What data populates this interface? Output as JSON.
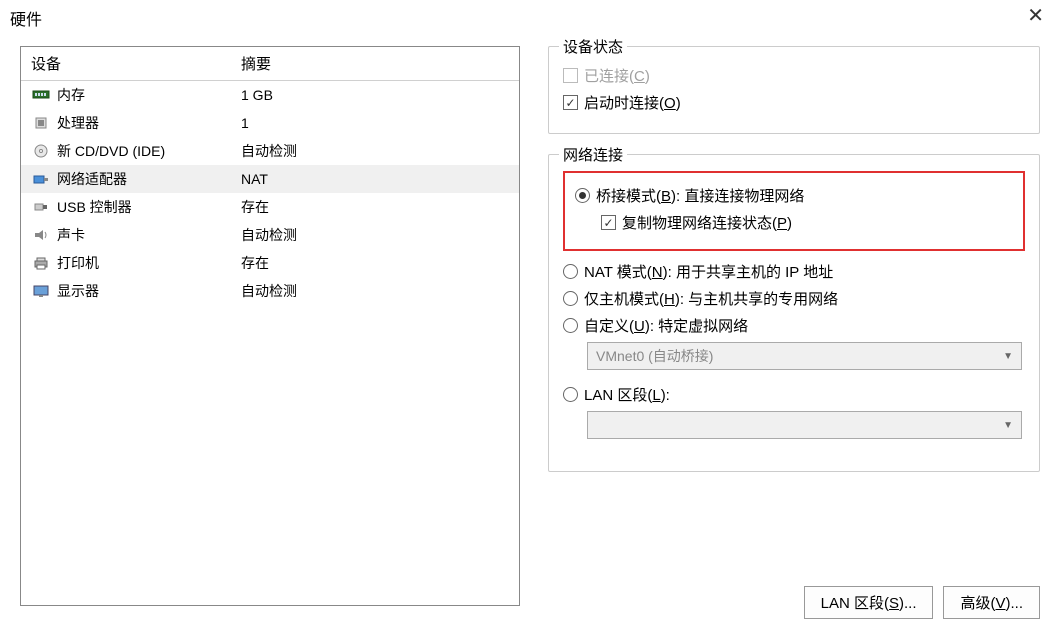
{
  "window_title": "硬件",
  "device_panel": {
    "col_device": "设备",
    "col_summary": "摘要",
    "rows": [
      {
        "icon": "memory-icon",
        "name": "内存",
        "summary": "1 GB",
        "selected": false
      },
      {
        "icon": "cpu-icon",
        "name": "处理器",
        "summary": "1",
        "selected": false
      },
      {
        "icon": "cd-icon",
        "name": "新 CD/DVD (IDE)",
        "summary": "自动检测",
        "selected": false
      },
      {
        "icon": "nic-icon",
        "name": "网络适配器",
        "summary": "NAT",
        "selected": true
      },
      {
        "icon": "usb-icon",
        "name": "USB 控制器",
        "summary": "存在",
        "selected": false
      },
      {
        "icon": "sound-icon",
        "name": "声卡",
        "summary": "自动检测",
        "selected": false
      },
      {
        "icon": "printer-icon",
        "name": "打印机",
        "summary": "存在",
        "selected": false
      },
      {
        "icon": "display-icon",
        "name": "显示器",
        "summary": "自动检测",
        "selected": false
      }
    ]
  },
  "status": {
    "legend": "设备状态",
    "connected_label": "已连接",
    "connected_accel": "C",
    "connected_checked": false,
    "connected_enabled": false,
    "connect_at_power_label": "启动时连接",
    "connect_at_power_accel": "O",
    "connect_at_power_checked": true
  },
  "network": {
    "legend": "网络连接",
    "bridge_label_pre": "桥接模式(",
    "bridge_accel": "B",
    "bridge_label_post": "): 直接连接物理网络",
    "bridge_selected": true,
    "replicate_label_pre": "复制物理网络连接状态(",
    "replicate_accel": "P",
    "replicate_label_post": ")",
    "replicate_checked": true,
    "nat_label_pre": "NAT 模式(",
    "nat_accel": "N",
    "nat_label_post": "): 用于共享主机的 IP 地址",
    "hostonly_label_pre": "仅主机模式(",
    "hostonly_accel": "H",
    "hostonly_label_post": "): 与主机共享的专用网络",
    "custom_label_pre": "自定义(",
    "custom_accel": "U",
    "custom_label_post": "): 特定虚拟网络",
    "custom_dropdown": "VMnet0 (自动桥接)",
    "lan_label_pre": "LAN 区段(",
    "lan_accel": "L",
    "lan_label_post": "):",
    "lan_dropdown": ""
  },
  "buttons": {
    "lan_segments_pre": "LAN 区段(",
    "lan_segments_accel": "S",
    "lan_segments_post": ")...",
    "advanced_pre": "高级(",
    "advanced_accel": "V",
    "advanced_post": ")..."
  }
}
